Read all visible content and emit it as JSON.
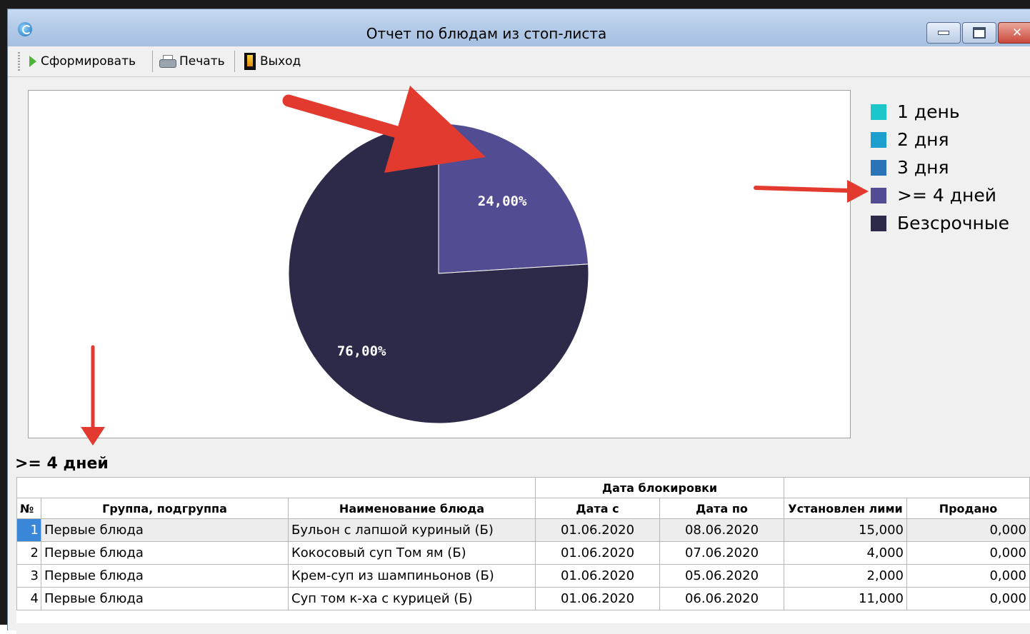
{
  "window": {
    "title": "Отчет по блюдам из стоп-листа"
  },
  "toolbar": {
    "generate_label": "Сформировать",
    "print_label": "Печать",
    "exit_label": "Выход"
  },
  "chart_data": {
    "type": "pie",
    "legend_position": "right",
    "categories": [
      "1 день",
      "2 дня",
      "3 дня",
      ">= 4 дней",
      "Безсрочные"
    ],
    "values": [
      0,
      0,
      0,
      24,
      76
    ],
    "data_labels": [
      "",
      "",
      "",
      "24,00%",
      "76,00%"
    ],
    "colors": [
      "#1cc7c9",
      "#1a9fcf",
      "#2b73b8",
      "#524d92",
      "#2c2a48"
    ],
    "highlighted": ">= 4 дней"
  },
  "section": {
    "selected_label": ">= 4 дней"
  },
  "table": {
    "group_header": "Дата блокировки",
    "columns": [
      "№",
      "Группа, подгруппа",
      "Наименование блюда",
      "Дата с",
      "Дата по",
      "Установлен лими",
      "Продано"
    ],
    "rows": [
      [
        "1",
        "Первые блюда",
        "Бульон с лапшой куриный (Б)",
        "01.06.2020",
        "08.06.2020",
        "15,000",
        "0,000"
      ],
      [
        "2",
        "Первые блюда",
        "Кокосовый суп Том ям (Б)",
        "01.06.2020",
        "07.06.2020",
        "4,000",
        "0,000"
      ],
      [
        "3",
        "Первые блюда",
        "Крем-суп из шампиньонов (Б)",
        "01.06.2020",
        "05.06.2020",
        "2,000",
        "0,000"
      ],
      [
        "4",
        "Первые блюда",
        "Суп том к-ха с курицей (Б)",
        "01.06.2020",
        "06.06.2020",
        "11,000",
        "0,000"
      ]
    ],
    "selected_row": 1
  }
}
